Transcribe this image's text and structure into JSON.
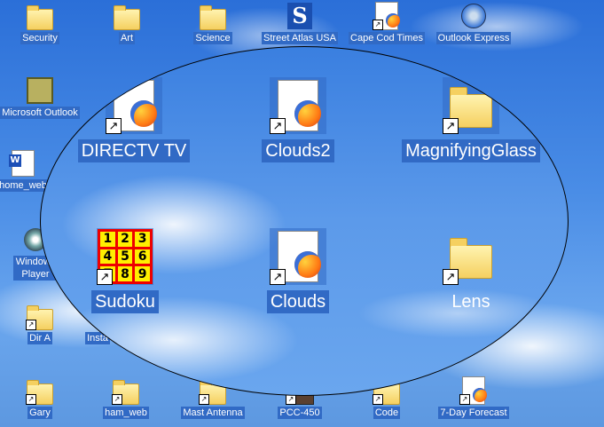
{
  "desktop_icons": [
    {
      "label": "Security",
      "type": "folder"
    },
    {
      "label": "Art",
      "type": "folder"
    },
    {
      "label": "Science",
      "type": "folder"
    },
    {
      "label": "Street Atlas USA",
      "type": "app"
    },
    {
      "label": "Cape Cod Times",
      "type": "firefox-doc"
    },
    {
      "label": "Outlook Express",
      "type": "app"
    },
    {
      "label": "Microsoft Outlook",
      "type": "app"
    },
    {
      "label": "home_web",
      "type": "word-doc"
    },
    {
      "label": "Windows Player",
      "type": "app"
    },
    {
      "label": "Dir A",
      "type": "folder"
    },
    {
      "label": "Insta",
      "type": "app"
    },
    {
      "label": "Gary",
      "type": "folder"
    },
    {
      "label": "ham_web",
      "type": "folder"
    },
    {
      "label": "Mast Antenna",
      "type": "folder"
    },
    {
      "label": "PCC-450",
      "type": "app"
    },
    {
      "label": "Code",
      "type": "folder"
    },
    {
      "label": "7-Day Forecast",
      "type": "firefox-doc"
    }
  ],
  "magnifier": {
    "icons": [
      {
        "label": "DIRECTV TV",
        "type": "firefox-doc"
      },
      {
        "label": "Clouds2",
        "type": "firefox-doc"
      },
      {
        "label": "MagnifyingGlass",
        "type": "folder"
      },
      {
        "label": "Sudoku",
        "type": "sudoku"
      },
      {
        "label": "Clouds",
        "type": "firefox-doc"
      },
      {
        "label": "Lens",
        "type": "folder"
      }
    ],
    "sudoku_digits": [
      "1",
      "2",
      "3",
      "4",
      "5",
      "6",
      "7",
      "8",
      "9"
    ]
  },
  "shortcut_glyph": "↗"
}
